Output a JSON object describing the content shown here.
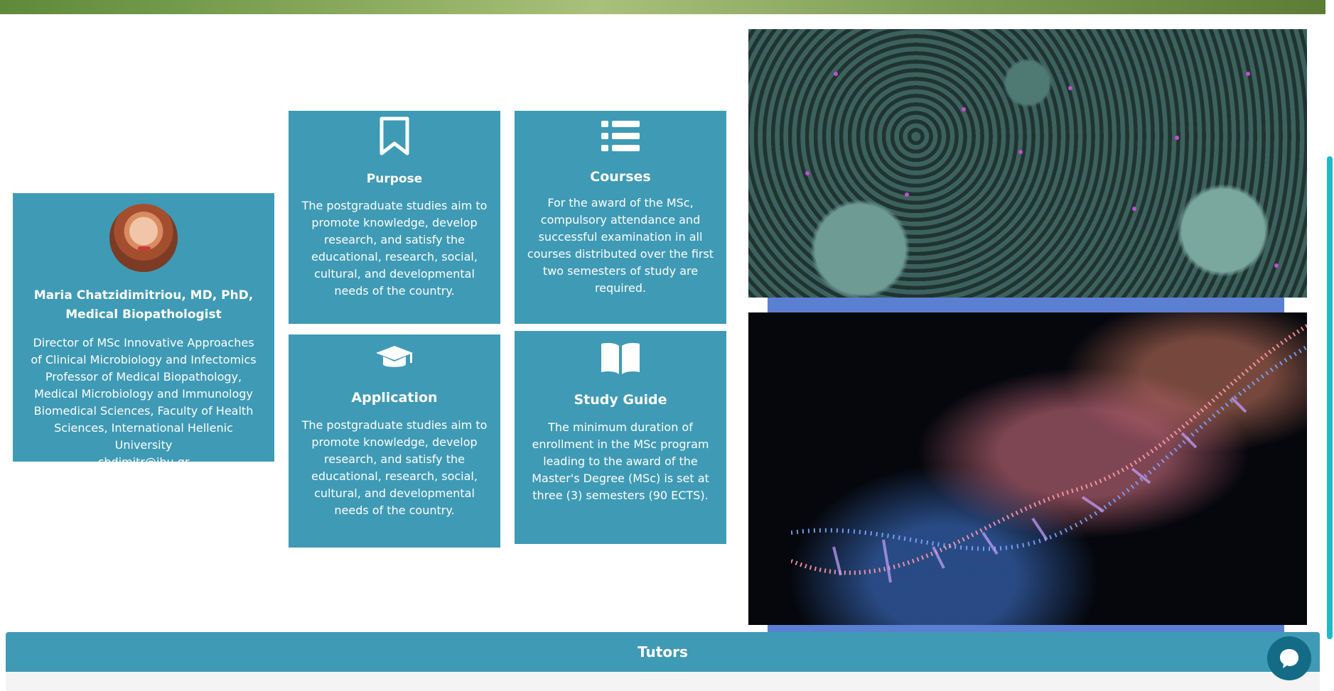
{
  "profile": {
    "name": "Maria Chatzidimitriou, MD, PhD, Medical Biopathologist",
    "description": "Director of MSc Innovative Approaches of Clinical Microbiology and Infectomics Professor of Medical Biopathology, Medical Microbiology and Immunology Biomedical Sciences, Faculty of Health Sciences, International Hellenic University",
    "email": "chdimitr@ihu.gr"
  },
  "features": {
    "purpose": {
      "icon": "bookmark-icon",
      "title": "Purpose",
      "text": "The postgraduate studies aim to promote knowledge, develop research, and satisfy the educational, research, social, cultural, and developmental needs of the country."
    },
    "courses": {
      "icon": "list-icon",
      "title": "Courses",
      "text": "For the award of the MSc, compulsory attendance and successful examination in all courses distributed over the first two semesters of study are required."
    },
    "application": {
      "icon": "graduation-cap-icon",
      "title": "Application",
      "text": "The postgraduate studies aim to promote knowledge, develop research, and satisfy the educational, research, social, cultural, and developmental needs of the country."
    },
    "study_guide": {
      "icon": "open-book-icon",
      "title": "Study Guide",
      "text": "The minimum duration of enrollment in the MSc program leading to the award of the Master's Degree (MSc) is set at three (3) semesters (90 ECTS)."
    }
  },
  "tutors_header": "Tutors",
  "colors": {
    "card": "#3f9ab5",
    "accent_frame": "#5b7fd1",
    "chat": "#136b86",
    "scrollbar": "#1eb9c8"
  }
}
